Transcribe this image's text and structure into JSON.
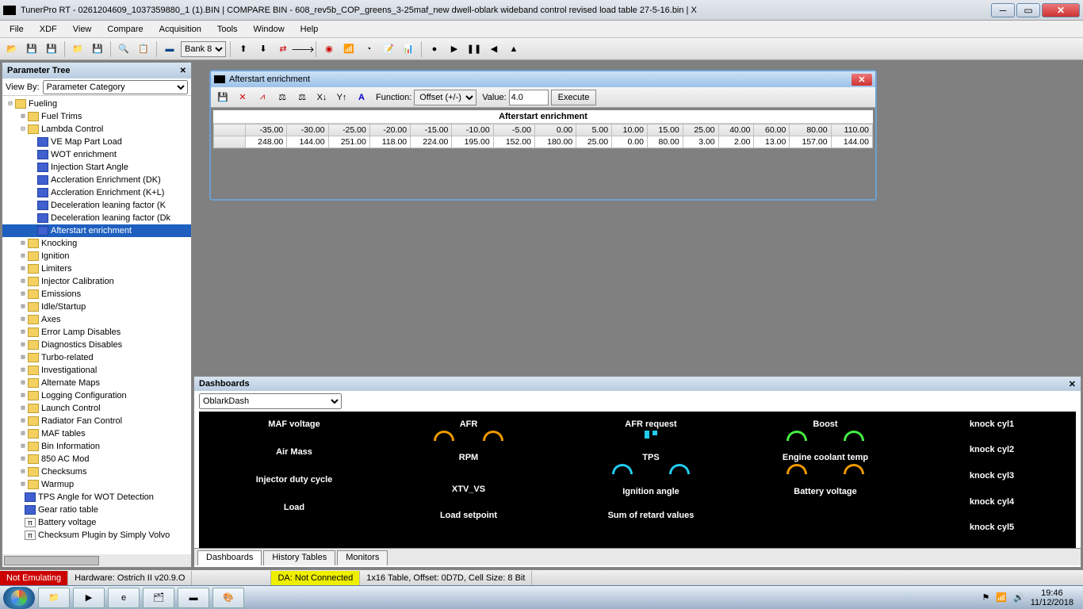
{
  "titlebar": {
    "text": "TunerPro RT - 0261204609_1037359880_1 (1).BIN | COMPARE BIN - 608_rev5b_COP_greens_3-25maf_new dwell-oblark wideband control revised load table 27-5-16.bin | X"
  },
  "menu": [
    "File",
    "XDF",
    "View",
    "Compare",
    "Acquisition",
    "Tools",
    "Window",
    "Help"
  ],
  "toolbar": {
    "bank_label": "Bank 8"
  },
  "tree": {
    "title": "Parameter Tree",
    "viewby_label": "View By:",
    "viewby_value": "Parameter Category",
    "root": "Fueling",
    "fuel_trims": "Fuel Trims",
    "lambda": "Lambda Control",
    "lambda_children": [
      "VE Map Part Load",
      "WOT enrichment",
      "Injection Start Angle",
      "Accleration Enrichment (DK)",
      "Accleration Enrichment (K+L)",
      "Deceleration leaning factor (K",
      "Deceleration leaning factor (Dk",
      "Afterstart enrichment"
    ],
    "folders": [
      "Knocking",
      "Ignition",
      "Limiters",
      "Injector Calibration",
      "Emissions",
      "Idle/Startup",
      "Axes",
      "Error Lamp Disables",
      "Diagnostics Disables",
      "Turbo-related",
      "Investigational",
      "Alternate Maps",
      "Logging Configuration",
      "Launch Control",
      "Radiator Fan Control",
      "MAF tables",
      "Bin Information",
      "850 AC Mod",
      "Checksums",
      "Warmup"
    ],
    "extras": [
      "TPS Angle for WOT Detection",
      "Gear ratio table",
      "Battery voltage",
      "Checksum Plugin by Simply Volvo"
    ]
  },
  "table_window": {
    "title": "Afterstart enrichment",
    "function_label": "Function:",
    "function_value": "Offset (+/-)",
    "value_label": "Value:",
    "value": "4.0",
    "execute": "Execute",
    "caption": "Afterstart enrichment",
    "headers": [
      "-35.00",
      "-30.00",
      "-25.00",
      "-20.00",
      "-15.00",
      "-10.00",
      "-5.00",
      "0.00",
      "5.00",
      "10.00",
      "15.00",
      "25.00",
      "40.00",
      "60.00",
      "80.00",
      "110.00"
    ],
    "row": [
      "248.00",
      "144.00",
      "251.00",
      "118.00",
      "224.00",
      "195.00",
      "152.00",
      "180.00",
      "25.00",
      "0.00",
      "80.00",
      "3.00",
      "2.00",
      "13.00",
      "157.00",
      "144.00"
    ]
  },
  "dashboards": {
    "title": "Dashboards",
    "select": "OblarkDash",
    "gauges": {
      "c1": [
        "MAF voltage",
        "Air Mass",
        "Injector duty cycle",
        "Load"
      ],
      "c2": [
        "AFR",
        "RPM",
        "XTV_VS",
        "Load setpoint"
      ],
      "c3": [
        "AFR request",
        "TPS",
        "Ignition angle",
        "Sum of retard values"
      ],
      "c4": [
        "Boost",
        "Engine coolant temp",
        "Battery voltage"
      ],
      "c5": [
        "knock cyl1",
        "knock cyl2",
        "knock cyl3",
        "knock cyl4",
        "knock cyl5"
      ]
    },
    "tabs": [
      "Dashboards",
      "History Tables",
      "Monitors"
    ]
  },
  "status": {
    "not_emulating": "Not Emulating",
    "hardware": "Hardware: Ostrich II v20.9.O",
    "da": "DA: Not Connected",
    "cell": "1x16 Table, Offset: 0D7D,  Cell Size: 8 Bit"
  },
  "tray": {
    "time": "19:46",
    "date": "11/12/2018"
  }
}
